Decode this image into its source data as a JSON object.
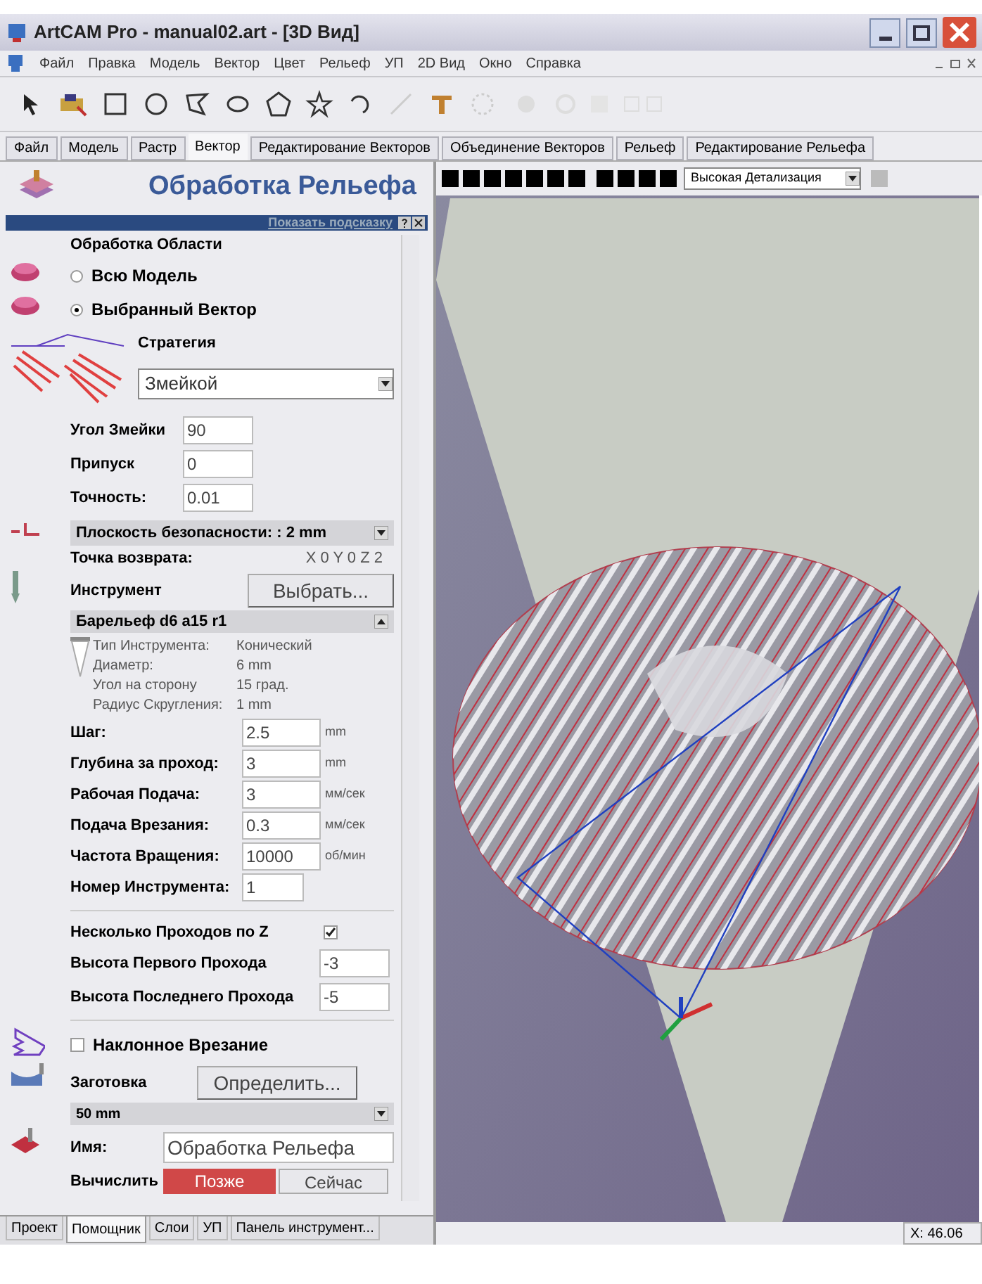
{
  "window": {
    "title": "ArtCAM Pro - manual02.art - [3D Вид]"
  },
  "menu": [
    "Файл",
    "Правка",
    "Модель",
    "Вектор",
    "Цвет",
    "Рельеф",
    "УП",
    "2D Вид",
    "Окно",
    "Справка"
  ],
  "ribbon_tabs": [
    {
      "label": "Файл",
      "selected": false
    },
    {
      "label": "Модель",
      "selected": false
    },
    {
      "label": "Растр",
      "selected": false
    },
    {
      "label": "Вектор",
      "selected": true
    },
    {
      "label": "Редактирование Векторов",
      "selected": false
    },
    {
      "label": "Объединение Векторов",
      "selected": false
    },
    {
      "label": "Рельеф",
      "selected": false
    },
    {
      "label": "Редактирование Рельефа",
      "selected": false
    }
  ],
  "panel": {
    "title": "Обработка Рельефа",
    "hint": "Показать подсказку",
    "area_heading": "Обработка Области",
    "area_options": [
      {
        "label": "Всю Модель",
        "selected": false
      },
      {
        "label": "Выбранный Вектор",
        "selected": true
      }
    ],
    "strategy_label": "Стратегия",
    "strategy": "Змейкой",
    "strategy_fields": [
      {
        "label": "Угол Змейки",
        "value": "90"
      },
      {
        "label": "Припуск",
        "value": "0"
      },
      {
        "label": "Точность:",
        "value": "0.01"
      }
    ],
    "safe_z": "Плоскость безопасности: : 2 mm",
    "home_label": "Точка возврата:",
    "home_value": "X 0 Y 0 Z 2",
    "tool_label": "Инструмент",
    "tool_button": "Выбрать...",
    "tool_name": "Барельеф d6 a15 r1",
    "tool_props": [
      {
        "label": "Тип Инструмента:",
        "value": "Конический"
      },
      {
        "label": "Диаметр:",
        "value": "6 mm"
      },
      {
        "label": "Угол на сторону",
        "value": "15 град."
      },
      {
        "label": "Радиус Скругления:",
        "value": "1 mm"
      }
    ],
    "params": [
      {
        "label": "Шаг:",
        "value": "2.5",
        "unit": "mm"
      },
      {
        "label": "Глубина за проход:",
        "value": "3",
        "unit": "mm"
      },
      {
        "label": "Рабочая Подача:",
        "value": "3",
        "unit": "мм/сек"
      },
      {
        "label": "Подача Врезания:",
        "value": "0.3",
        "unit": "мм/сек"
      },
      {
        "label": "Частота Вращения:",
        "value": "10000",
        "unit": "об/мин"
      },
      {
        "label": "Номер Инструмента:",
        "value": "1"
      }
    ],
    "multipass": {
      "label": "Несколько Проходов по Z",
      "checked": true
    },
    "pass_fields": [
      {
        "label": "Высота Первого Прохода",
        "value": "-3"
      },
      {
        "label": "Высота Последнего Прохода",
        "value": "-5"
      }
    ],
    "ramp": {
      "label": "Наклонное Врезание",
      "checked": false
    },
    "blank_label": "Заготовка",
    "blank_button": "Определить...",
    "blank_size": "50 mm",
    "name_label": "Имя:",
    "name_value": "Обработка Рельефа",
    "calc_label": "Вычислить",
    "calc_buttons": [
      "Позже",
      "Сейчас"
    ]
  },
  "panel_tabs": [
    {
      "label": "Проект",
      "selected": false
    },
    {
      "label": "Помощник",
      "selected": true
    },
    {
      "label": "Слои",
      "selected": false
    },
    {
      "label": "УП",
      "selected": false
    },
    {
      "label": "Панель инструмент...",
      "selected": false
    }
  ],
  "view": {
    "detail": "Высокая Детализация"
  },
  "status_bar": {
    "coords": "X: 46.06"
  }
}
